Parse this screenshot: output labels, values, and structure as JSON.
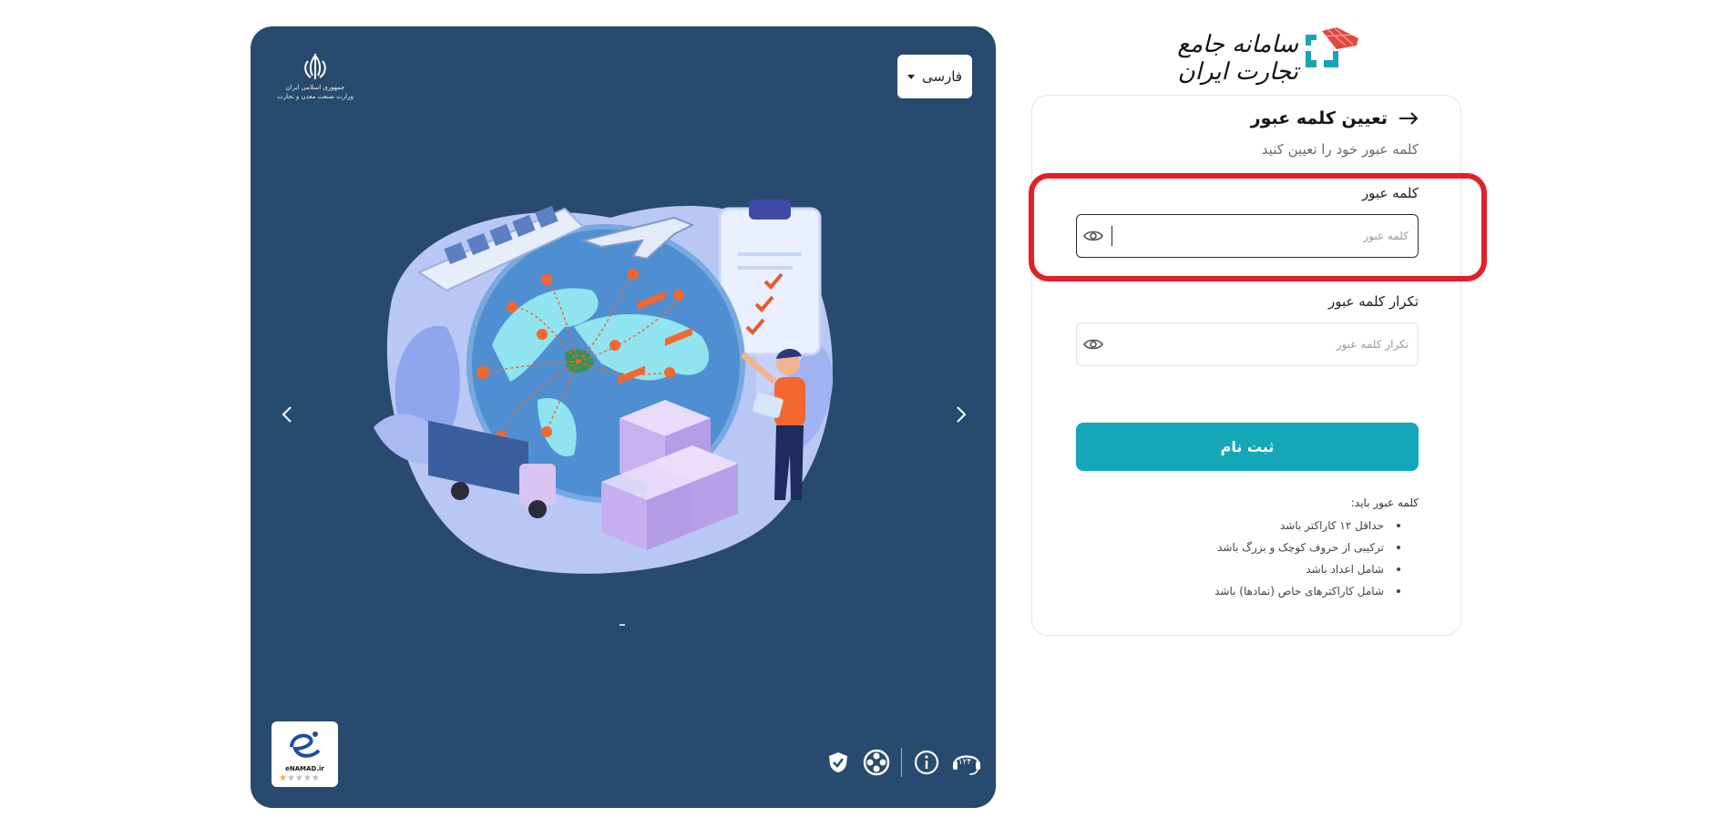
{
  "hero": {
    "language": "فارسی",
    "emblem_caption_line1": "جمهوری اسلامی ایران",
    "emblem_caption_line2": "وزارت صنعت معدن و تجارت",
    "enamad_label": "eNAMAD.ir",
    "support_number": "۱۲۴",
    "slide_count_indicator": "-"
  },
  "brand": {
    "title": "سامانه جامع تجارت ایران",
    "color": "#1aa3b5"
  },
  "form": {
    "title": "تعیین کلمه عبور",
    "subtitle": "کلمه عبور خود را تعیین کنید",
    "password_label": "کلمه عبور",
    "password_placeholder": "کلمه عبور",
    "password_value": "",
    "confirm_label": "تکرار کلمه عبور",
    "confirm_placeholder": "تکرار کلمه عبور",
    "confirm_value": "",
    "submit_label": "ثبت نام",
    "rules_title": "کلمه عبور باید:",
    "rules": [
      "حداقل ۱۲ کاراکتر باشد",
      "ترکیبی از حروف کوچک و بزرگ باشد",
      "شامل اعداد باشد",
      "شامل کاراکترهای خاص (نمادها) باشد"
    ]
  },
  "colors": {
    "panel_bg": "#284a6e",
    "accent": "#14a7b8",
    "highlight": "#e3202a"
  }
}
